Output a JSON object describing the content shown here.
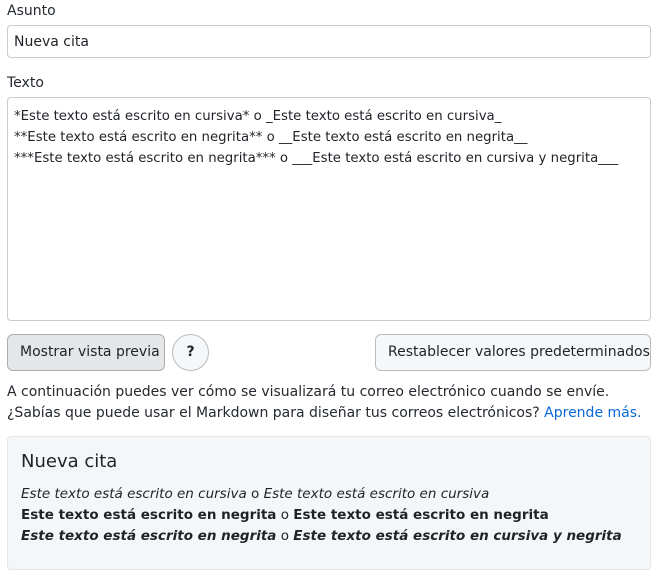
{
  "subject": {
    "label": "Asunto",
    "value": "Nueva cita"
  },
  "text": {
    "label": "Texto",
    "value": "*Este texto está escrito en cursiva* o _Este texto está escrito en cursiva_\n**Este texto está escrito en negrita** o __Este texto está escrito en negrita__\n***Este texto está escrito en negrita*** o ___Este texto está escrito en cursiva y negrita___"
  },
  "buttons": {
    "preview": "Mostrar vista previa",
    "help": "?",
    "reset": "Restablecer valores predeterminados"
  },
  "info": {
    "text": "A continuación puedes ver cómo se visualizará tu correo electrónico cuando se envíe. ¿Sabías que puede usar el Markdown para diseñar tus correos electrónicos? ",
    "link": "Aprende más."
  },
  "preview": {
    "title": "Nueva cita",
    "line1": {
      "a": "Este texto está escrito en cursiva",
      "sep": " o ",
      "b": "Este texto está escrito en cursiva"
    },
    "line2": {
      "a": "Este texto está escrito en negrita",
      "sep": " o ",
      "b": "Este texto está escrito en negrita"
    },
    "line3": {
      "a": "Este texto está escrito en negrita",
      "sep": " o ",
      "b": "Este texto está escrito en cursiva y negrita"
    }
  },
  "colors": {
    "link": "#0969da",
    "preview_background": "#f5f6f8"
  }
}
